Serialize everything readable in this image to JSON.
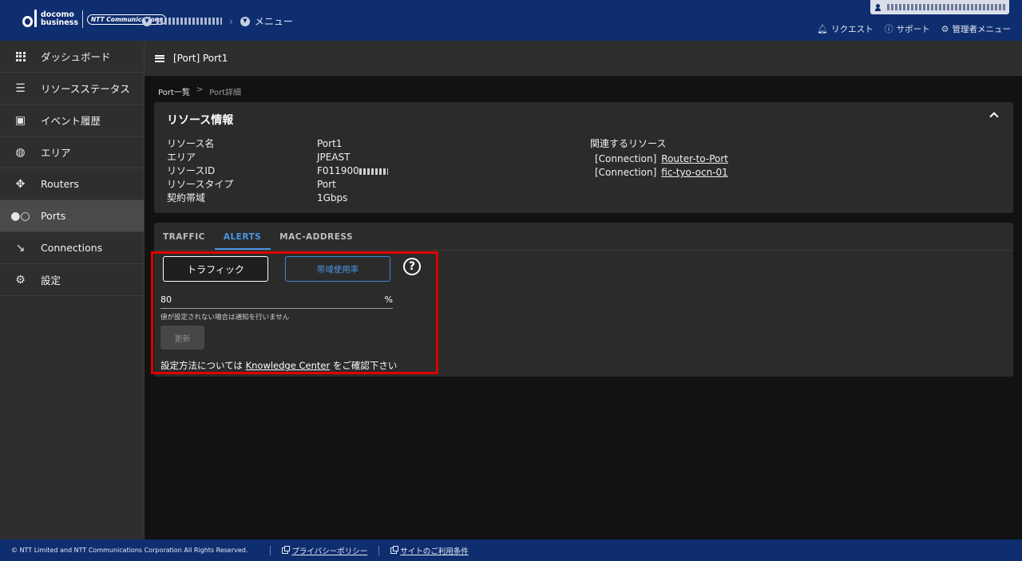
{
  "header": {
    "logo_line1": "docomo",
    "logo_line2": "business",
    "logo_ntt": "NTT Communications",
    "nav_menu": "メニュー",
    "menu_request": "リクエスト",
    "menu_support": "サポート",
    "menu_admin": "管理者メニュー"
  },
  "sidebar": {
    "items": [
      {
        "label": "ダッシュボード",
        "icon": "dashboard-icon"
      },
      {
        "label": "リソースステータス",
        "icon": "list-check-icon"
      },
      {
        "label": "イベント履歴",
        "icon": "calendar-check-icon"
      },
      {
        "label": "エリア",
        "icon": "globe-icon"
      },
      {
        "label": "Routers",
        "icon": "router-icon"
      },
      {
        "label": "Ports",
        "icon": "toggle-icon"
      },
      {
        "label": "Connections",
        "icon": "connection-icon"
      },
      {
        "label": "設定",
        "icon": "gear-icon"
      }
    ]
  },
  "topbar": {
    "title": "[Port] Port1"
  },
  "breadcrumb": {
    "parent": "Port一覧",
    "sep": ">",
    "current": "Port詳細"
  },
  "resource": {
    "title": "リソース情報",
    "labels": [
      "リソース名",
      "エリア",
      "リソースID",
      "リソースタイプ",
      "契約帯域"
    ],
    "name": "Port1",
    "area": "JPEAST",
    "id_prefix": "F011900",
    "type": "Port",
    "bandwidth": "1Gbps",
    "related_title": "関連するリソース",
    "related": [
      {
        "type": "[Connection]",
        "name": "Router-to-Port"
      },
      {
        "type": "[Connection]",
        "name": "fic-tyo-ocn-01"
      }
    ]
  },
  "tabs": [
    "TRAFFIC",
    "ALERTS",
    "MAC-ADDRESS"
  ],
  "alerts": {
    "btn_traffic": "トラフィック",
    "btn_bandwidth": "帯域使用率",
    "threshold_value": "80",
    "threshold_unit": "%",
    "hint": "値が設定されない場合は通知を行いません",
    "update": "更新",
    "note_prefix": "設定方法については",
    "note_link": "Knowledge Center",
    "note_suffix": "をご確認下さい"
  },
  "footer": {
    "copyright": "© NTT Limited and NTT Communications Corporation All Rights Reserved.",
    "privacy": "プライバシーポリシー",
    "terms": "サイトのご利用条件"
  },
  "colors": {
    "header": "#0f2e6f",
    "accent": "#4a95e6",
    "highlight": "#e00000"
  }
}
